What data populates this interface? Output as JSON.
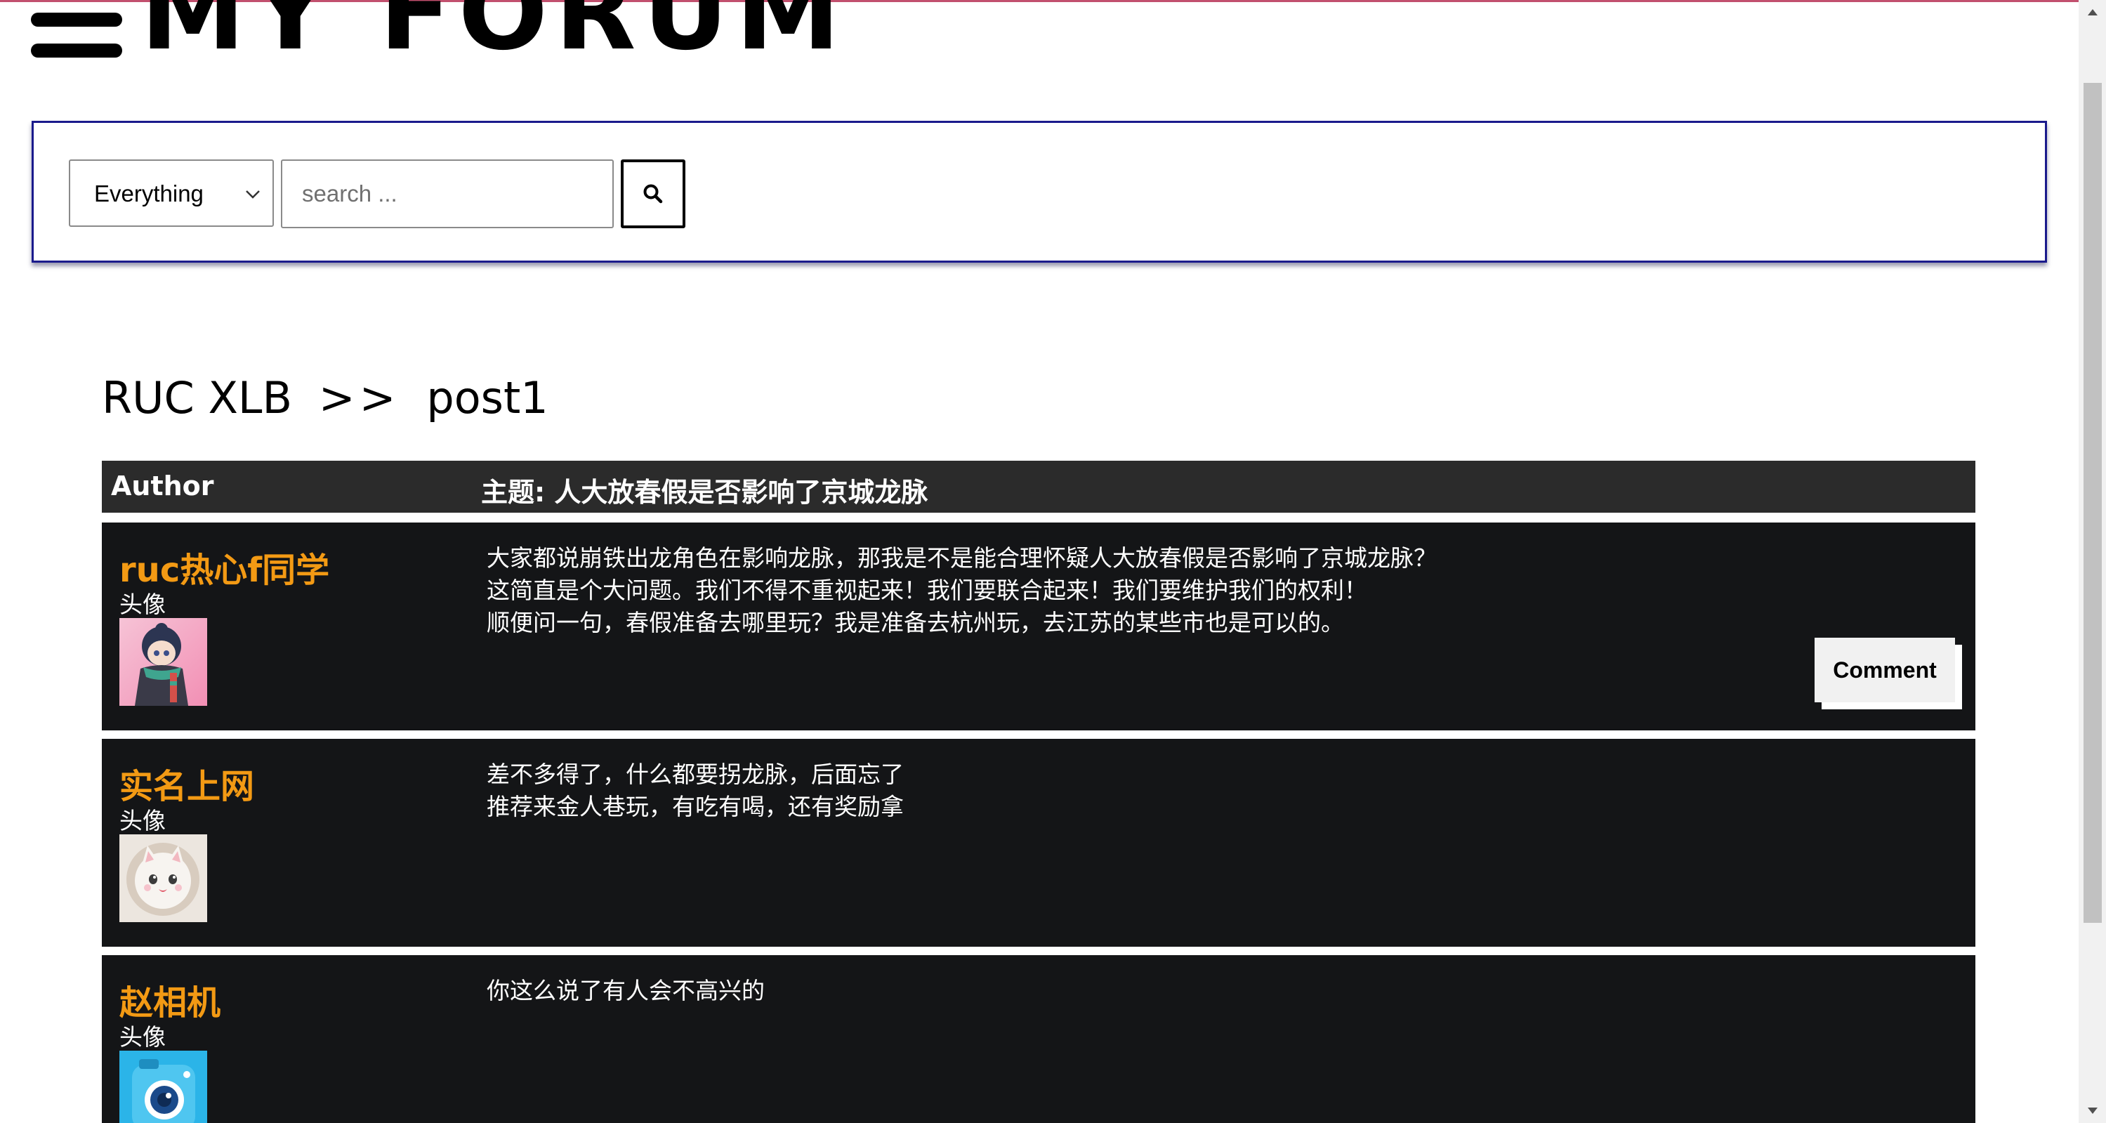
{
  "header": {
    "logo_text": "MY FORUM",
    "menu_icon": "hamburger-menu-icon"
  },
  "search": {
    "scope_selected": "Everything",
    "placeholder": "search ...",
    "button_icon": "search-icon"
  },
  "breadcrumb": {
    "board": "RUC XLB",
    "separator": ">>",
    "post": "post1"
  },
  "table": {
    "author_header": "Author",
    "topic_header": "主题: 人大放春假是否影响了京城龙脉"
  },
  "posts": [
    {
      "author": "ruc热心f同学",
      "avatar_label": "头像",
      "lines": [
        "大家都说崩铁出龙角色在影响龙脉，那我是不是能合理怀疑人大放春假是否影响了京城龙脉？",
        "这简直是个大问题。我们不得不重视起来！我们要联合起来！我们要维护我们的权利！",
        "顺便问一句，春假准备去哪里玩？我是准备去杭州玩，去江苏的某些市也是可以的。"
      ],
      "comment_label": "Comment"
    },
    {
      "author": "实名上网",
      "avatar_label": "头像",
      "lines": [
        "差不多得了，什么都要拐龙脉，后面忘了",
        "推荐来金人巷玩，有吃有喝，还有奖励拿"
      ]
    },
    {
      "author": "赵相机",
      "avatar_label": "头像",
      "lines": [
        "你这么说了有人会不高兴的"
      ]
    }
  ],
  "colors": {
    "author_name": "#f39a14",
    "row_bg": "#141517",
    "header_bg": "#2b2b2b",
    "search_border": "#1a1a8c"
  }
}
